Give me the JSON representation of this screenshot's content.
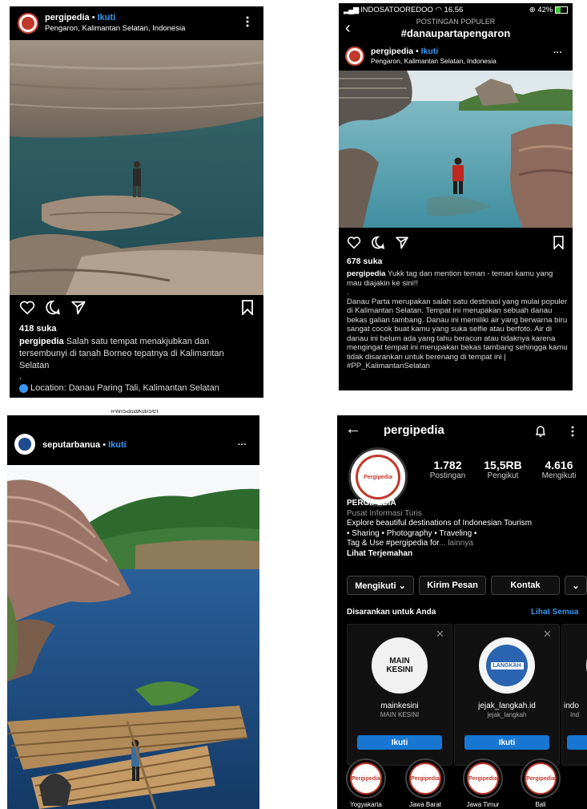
{
  "post1": {
    "username": "pergipedia",
    "dot": "•",
    "follow": "Ikuti",
    "location": "Pengaron, Kalimantan Selatan, Indonesia",
    "likes": "418 suka",
    "caption_user": "pergipedia",
    "caption_text": "Salah satu tempat menakjubkan dan tersembunyi di tanah Borneo tepatnya di Kalimantan Selatan",
    "dot_line": ".",
    "location_caption": "Location: Danau Paring Tali, Kalimantan Selatan"
  },
  "post2": {
    "carrier": "INDOSATOOREDOO",
    "time": "16.56",
    "battery": "42%",
    "header_sub": "POSTINGAN POPULER",
    "header_tag": "#danaupartapengaron",
    "username": "pergipedia",
    "dot": "•",
    "follow": "Ikuti",
    "location": "Pengaron, Kalimantan Selatan, Indonesia",
    "likes": "678 suka",
    "caption_user": "pergipedia",
    "caption_intro": "Yukk tag dan mention teman - teman kamu yang mau diajakin ke sini!!",
    "caption_dot": ".",
    "caption_body": "Danau Parta merupakan salah satu destinasi yang mulai populer di Kalimantan Selatan. Tempat ini merupakan sebuah danau bekas galian tambang. Danau ini memiliki air yang berwarna biru sangat cocok buat kamu yang suka selfie atau berfoto. Air di danau ini belum ada yang tahu beracun atau tidaknya karena mengingat tempat ini merupakan bekas tambang sehingga kamu tidak disarankan untuk berenang di tempat ini |",
    "caption_tag": "#PP_KalimantanSelatan"
  },
  "post3": {
    "top_text": "#wisatakalsel",
    "username": "seputarbanua",
    "dot": "•",
    "follow": "Ikuti",
    "more": "···"
  },
  "profile": {
    "back": "←",
    "username": "pergipedia",
    "stats": [
      {
        "value": "1.782",
        "label": "Postingan"
      },
      {
        "value": "15,5RB",
        "label": "Pengikut"
      },
      {
        "value": "4.616",
        "label": "Mengikuti"
      }
    ],
    "name": "PERGIPEDIA",
    "category": "Pusat Informasi Turis",
    "bio_line1": "Explore beautiful destinations of Indonesian Tourism",
    "bio_line2": "• Sharing • Photography • Traveling •",
    "bio_line3": "Tag & Use #pergipedia for",
    "bio_more": "... lainnya",
    "translate": "Lihat Terjemahan",
    "btn_following": "Mengikuti ⌄",
    "btn_message": "Kirim Pesan",
    "btn_contact": "Kontak",
    "btn_more": "⌄",
    "suggest_title": "Disarankan untuk Anda",
    "suggest_all": "Lihat Semua",
    "suggestions": [
      {
        "user": "mainkesini",
        "name": "MAIN KESINI",
        "follow": "Ikuti",
        "logo": "MAIN KESINI"
      },
      {
        "user": "jejak_langkah.id",
        "name": "jejak_langkah",
        "follow": "Ikuti",
        "logo": "LANGKAH"
      },
      {
        "user": "indo",
        "name": "Ind",
        "follow": "",
        "logo": ""
      }
    ],
    "highlights": [
      "Yogyakarta",
      "Jawa Barat",
      "Jawa Timur",
      "Bali"
    ],
    "highlight_logo": "Pergipedia"
  },
  "colors": {
    "accent_blue": "#3897f0",
    "button_blue": "#1877d2",
    "brand_red": "#c0392b"
  }
}
